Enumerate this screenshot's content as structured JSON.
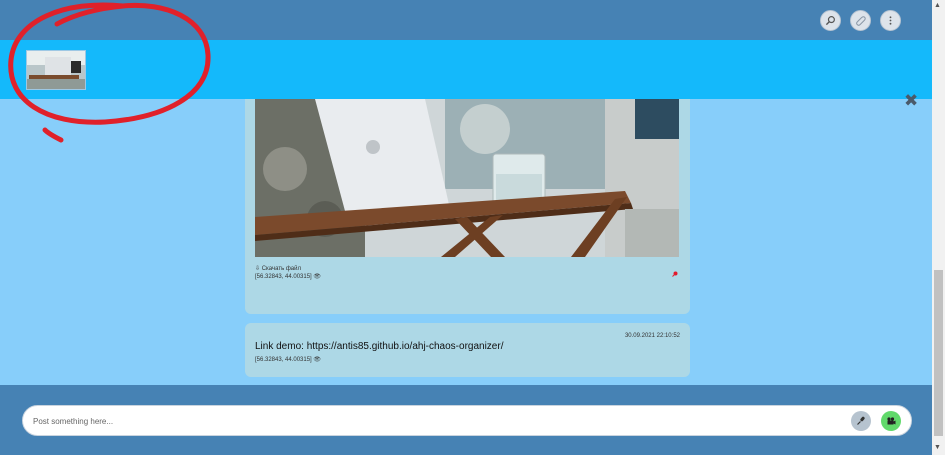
{
  "header": {
    "search_icon": "search-icon",
    "attach_icon": "paperclip-icon",
    "menu_icon": "more-vertical-icon"
  },
  "pinned": {
    "close_label": "✖"
  },
  "messages": [
    {
      "download_label": "⇩ Скачать файл",
      "coords": "[56.32843, 44.00315] 👁"
    },
    {
      "date": "30.09.2021 22:10:52",
      "text": "Link demo: https://antis85.github.io/ahj-chaos-organizer/",
      "coords": "[56.32843, 44.00315] 👁"
    }
  ],
  "composer": {
    "placeholder": "Post something here..."
  },
  "colors": {
    "header": "#4682b4",
    "pinned": "#14b9fb",
    "feed": "#87cefa",
    "card": "#add8e6",
    "annotation": "#e0212a"
  }
}
